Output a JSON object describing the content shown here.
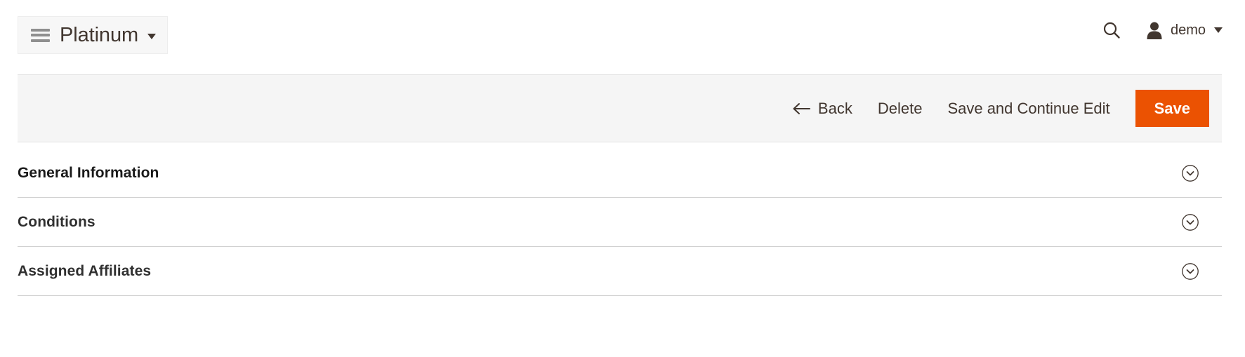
{
  "header": {
    "menu_button": {
      "icon": "hamburger-icon",
      "label": "Platinum",
      "caret": "chevron-down-icon"
    },
    "search": {
      "icon": "search-icon"
    },
    "user": {
      "icon": "user-avatar-icon",
      "name": "demo",
      "caret": "chevron-down-icon"
    }
  },
  "toolbar": {
    "back_label": "Back",
    "back_icon": "arrow-left-icon",
    "delete_label": "Delete",
    "save_continue_label": "Save and Continue Edit",
    "save_label": "Save",
    "primary_color": "#eb5202",
    "background_color": "#f5f5f5"
  },
  "sections": [
    {
      "title": "General Information",
      "toggle_icon": "chevron-down-circle-icon",
      "expanded": false
    },
    {
      "title": "Conditions",
      "toggle_icon": "chevron-down-circle-icon",
      "expanded": false
    },
    {
      "title": "Assigned Affiliates",
      "toggle_icon": "chevron-down-circle-icon",
      "expanded": false
    }
  ]
}
